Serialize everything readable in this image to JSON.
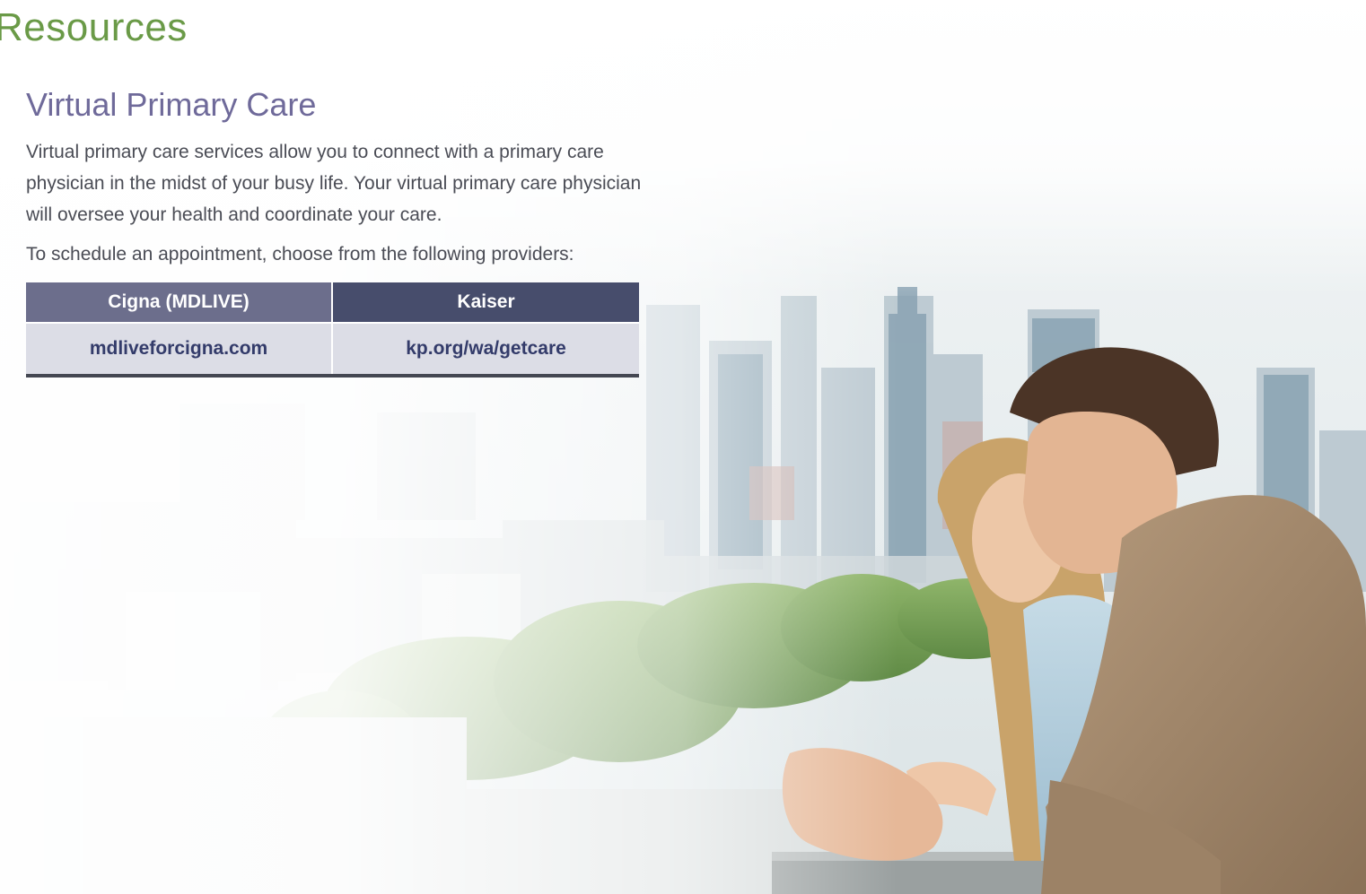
{
  "page": {
    "title": "Resources",
    "section_title": "Virtual Primary Care",
    "description": "Virtual primary care services allow you to connect with a primary care physician in the midst of your busy life. Your virtual primary care physician will oversee your health and coordinate your care.",
    "schedule_prompt": "To schedule an appointment, choose from the following providers:"
  },
  "providers_table": {
    "headers": [
      "Cigna (MDLIVE)",
      "Kaiser"
    ],
    "rows": [
      [
        "mdliveforcigna.com",
        "kp.org/wa/getcare"
      ]
    ]
  },
  "colors": {
    "title_green": "#6a9a47",
    "section_purple": "#6f6a9a",
    "header_left": "#6c6e8c",
    "header_right": "#474d6c",
    "cell_bg": "#dcdde6",
    "link_text": "#333b6a"
  },
  "background_photo": {
    "subject": "couple-overlooking-city-skyline-image"
  }
}
